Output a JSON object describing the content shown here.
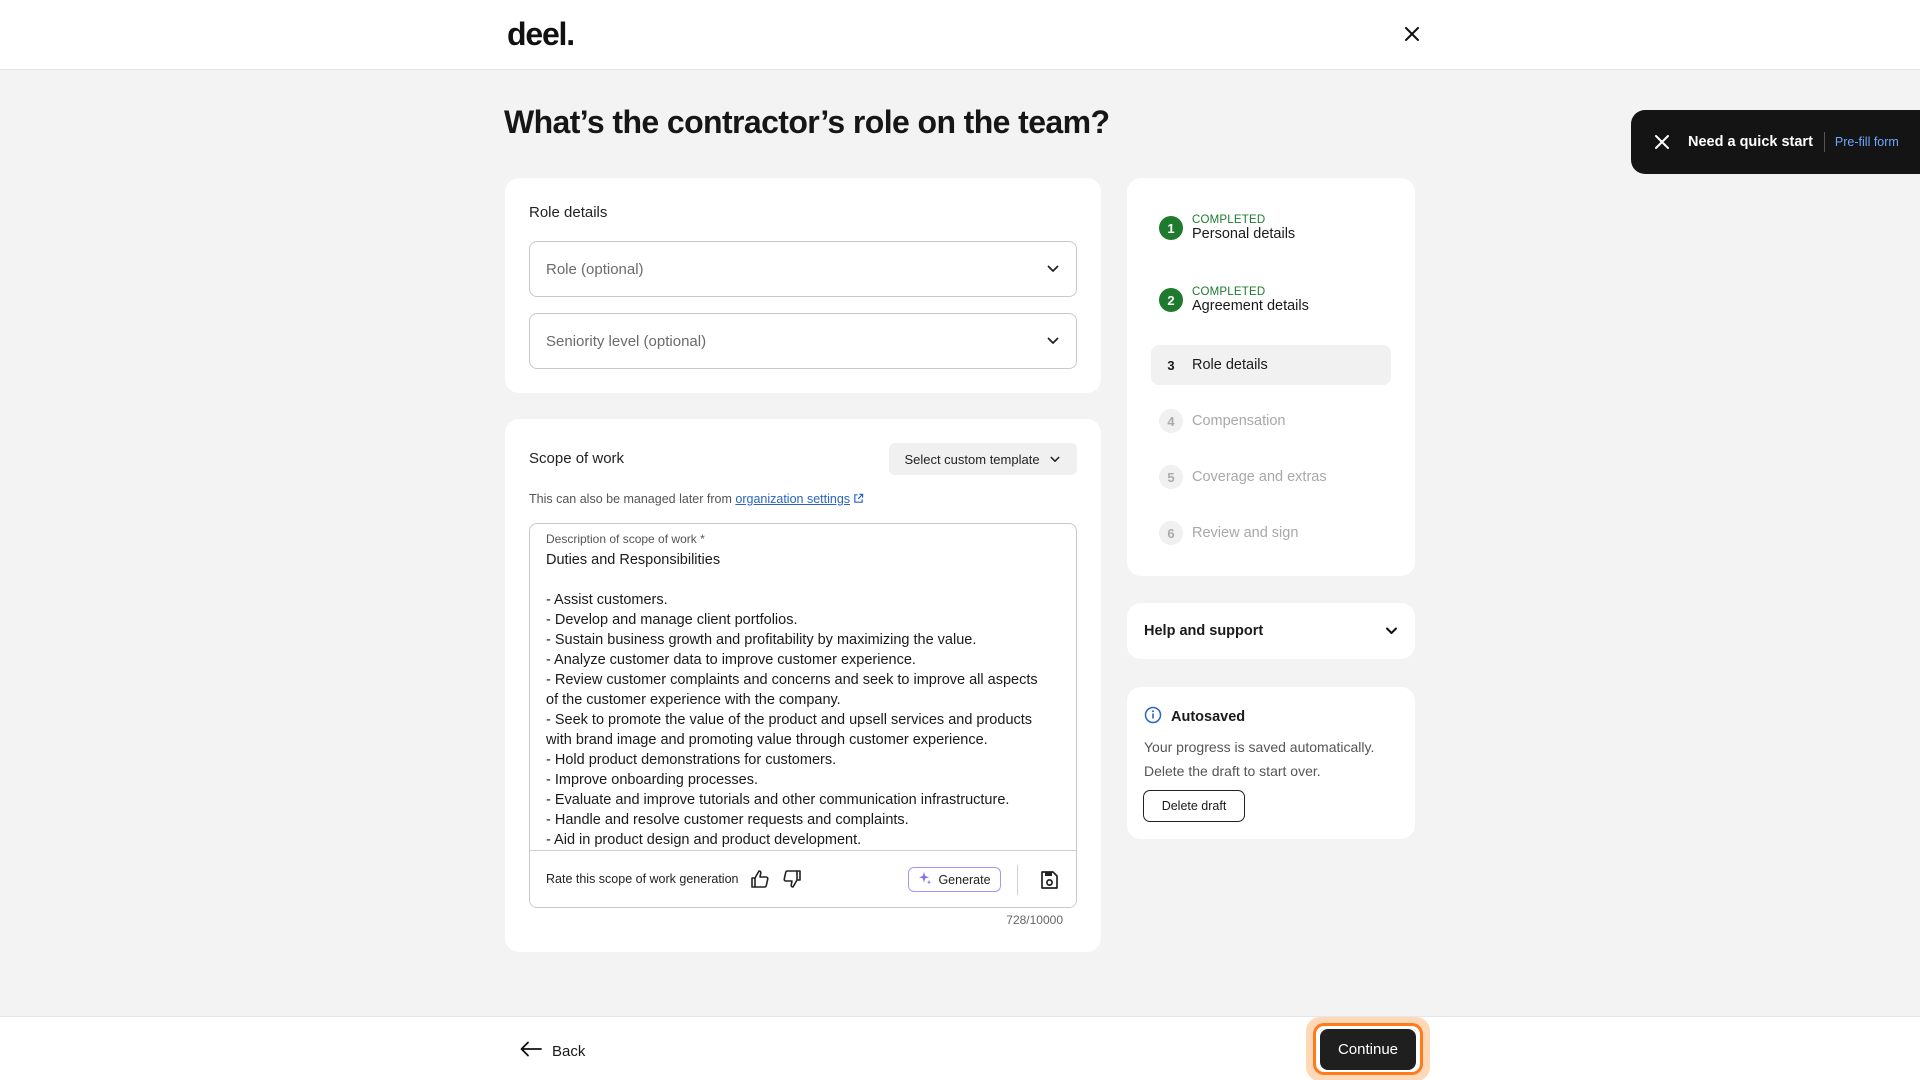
{
  "brand": {
    "logo_text": "deel."
  },
  "page": {
    "title": "What’s the contractor’s role on the team?"
  },
  "role_details": {
    "section_label": "Role details",
    "role_placeholder": "Role (optional)",
    "seniority_placeholder": "Seniority level (optional)"
  },
  "scope": {
    "section_label": "Scope of work",
    "template_button": "Select custom template",
    "helper_text": "This can also be managed later from",
    "helper_link": "organization settings",
    "field_label": "Description of scope of work *",
    "lines": [
      "Duties and Responsibilities",
      "",
      "- Assist customers.",
      "- Develop and manage client portfolios.",
      "- Sustain business growth and profitability by maximizing the value.",
      "- Analyze customer data to improve customer experience.",
      "- Review customer complaints and concerns and seek to improve all aspects",
      "of the customer experience with the company.",
      "- Seek to promote the value of the product and upsell services and products",
      "with brand image and promoting value through customer experience.",
      "- Hold product demonstrations for customers.",
      "- Improve onboarding processes.",
      "- Evaluate and improve tutorials and other communication infrastructure.",
      "- Handle and resolve customer requests and complaints.",
      "- Aid in product design and product development."
    ],
    "rate_label": "Rate this scope of work generation",
    "generate_button": "Generate",
    "char_count": "728/10000"
  },
  "steps": [
    {
      "number": "1",
      "status": "COMPLETED",
      "label": "Personal details",
      "state": "done"
    },
    {
      "number": "2",
      "status": "COMPLETED",
      "label": "Agreement details",
      "state": "done"
    },
    {
      "number": "3",
      "status": "",
      "label": "Role details",
      "state": "current"
    },
    {
      "number": "4",
      "status": "",
      "label": "Compensation",
      "state": "todo"
    },
    {
      "number": "5",
      "status": "",
      "label": "Coverage and extras",
      "state": "todo"
    },
    {
      "number": "6",
      "status": "",
      "label": "Review and sign",
      "state": "todo"
    }
  ],
  "help": {
    "label": "Help and support"
  },
  "autosave": {
    "title": "Autosaved",
    "body": "Your progress is saved automatically. Delete the draft to start over.",
    "delete_button": "Delete draft"
  },
  "quickstart": {
    "text": "Need a quick start",
    "link": "Pre-fill form"
  },
  "footer": {
    "back_label": "Back",
    "continue_label": "Continue"
  },
  "colors": {
    "accent_green": "#1f7a2e",
    "link_blue": "#2a63c4",
    "focus_orange": "#ff7a1a",
    "generate_purple": "#a896f5"
  }
}
